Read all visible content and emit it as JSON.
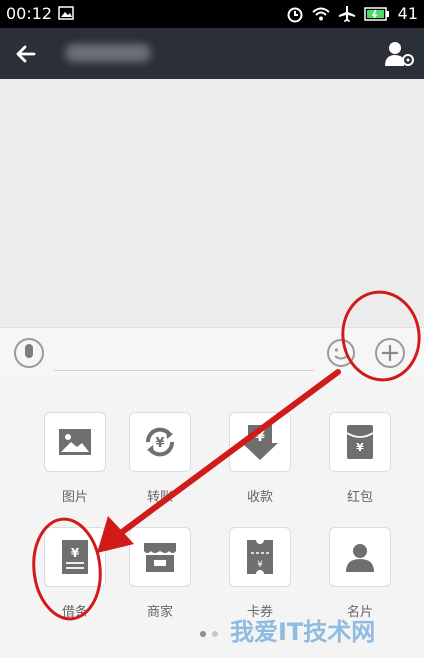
{
  "statusbar": {
    "time": "00:12",
    "battery": "41"
  },
  "input": {
    "placeholder": ""
  },
  "panel": {
    "items": [
      {
        "label": "图片",
        "icon": "image-icon"
      },
      {
        "label": "转账",
        "icon": "transfer-icon"
      },
      {
        "label": "收款",
        "icon": "receive-money-icon"
      },
      {
        "label": "红包",
        "icon": "red-packet-icon"
      },
      {
        "label": "借条",
        "icon": "iou-icon"
      },
      {
        "label": "商家",
        "icon": "shop-icon"
      },
      {
        "label": "卡券",
        "icon": "coupon-icon"
      },
      {
        "label": "名片",
        "icon": "contact-card-icon"
      }
    ]
  },
  "watermark": {
    "text": "我爱IT技术网"
  },
  "colors": {
    "accent_annotation": "#d11a1a",
    "titlebar": "#2b2f38",
    "icon": "#6f6f6f"
  }
}
